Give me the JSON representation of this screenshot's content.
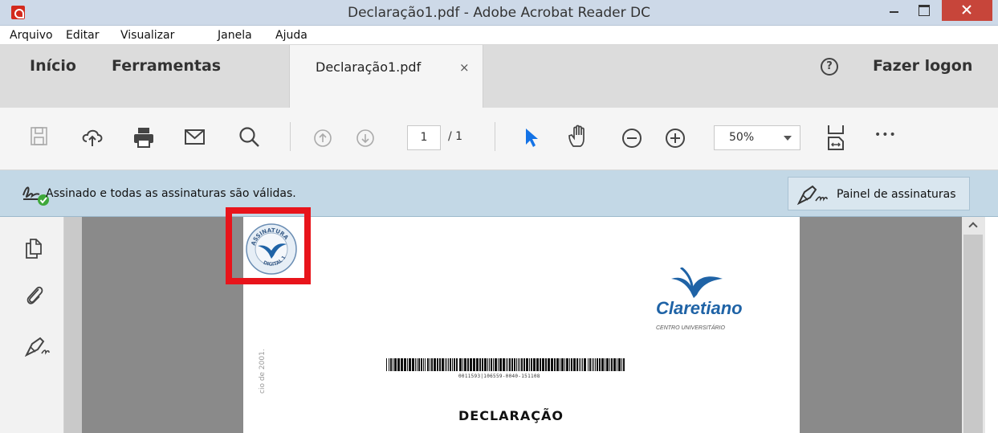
{
  "window": {
    "title": "Declaração1.pdf - Adobe Acrobat Reader DC",
    "close_color": "#c7453a"
  },
  "menu": {
    "items": [
      "Arquivo",
      "Editar",
      "Visualizar",
      "Janela",
      "Ajuda"
    ]
  },
  "tabs": {
    "home": "Início",
    "tools": "Ferramentas",
    "document": "Declaração1.pdf",
    "close_glyph": "×",
    "help_glyph": "?",
    "login": "Fazer logon"
  },
  "toolbar": {
    "page_current": "1",
    "page_total": "/ 1",
    "zoom": "50%",
    "more_glyph": "•••",
    "icons": [
      "save-icon",
      "cloud-upload-icon",
      "print-icon",
      "email-icon",
      "search-icon",
      "page-up-icon",
      "page-down-icon",
      "select-cursor-icon",
      "hand-tool-icon",
      "zoom-out-icon",
      "zoom-in-icon",
      "page-fit-icon",
      "more-icon"
    ]
  },
  "signature_bar": {
    "message": "Assinado e todas as assinaturas são válidas.",
    "panel_button": "Painel de assinaturas",
    "valid_color": "#3ea83a"
  },
  "document": {
    "seal_text_top": "ASSINATURA",
    "seal_text_bottom": "DIGITAL 1",
    "logo_name": "Claretiano",
    "logo_subtitle": "CENTRO UNIVERSITÁRIO",
    "barcode_number": "0011593|106559-0040-151108",
    "side_text": "cio de 2001.",
    "heading": "DECLARAÇÃO",
    "highlight_color": "#e8141b"
  }
}
